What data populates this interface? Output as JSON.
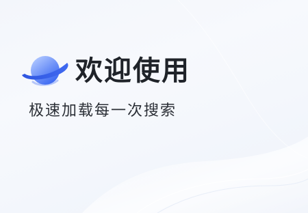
{
  "welcome": {
    "title": "欢迎使用",
    "subtitle": "极速加载每一次搜索"
  },
  "logo": {
    "icon": "planet-icon",
    "colors": {
      "planet_light": "#8fb0ff",
      "planet_dark": "#3d6af2",
      "ring": "#2f56e0"
    }
  },
  "colors": {
    "background": "#f4f7fc",
    "title_text": "#1f2329",
    "subtitle_text": "#2b2f36"
  }
}
